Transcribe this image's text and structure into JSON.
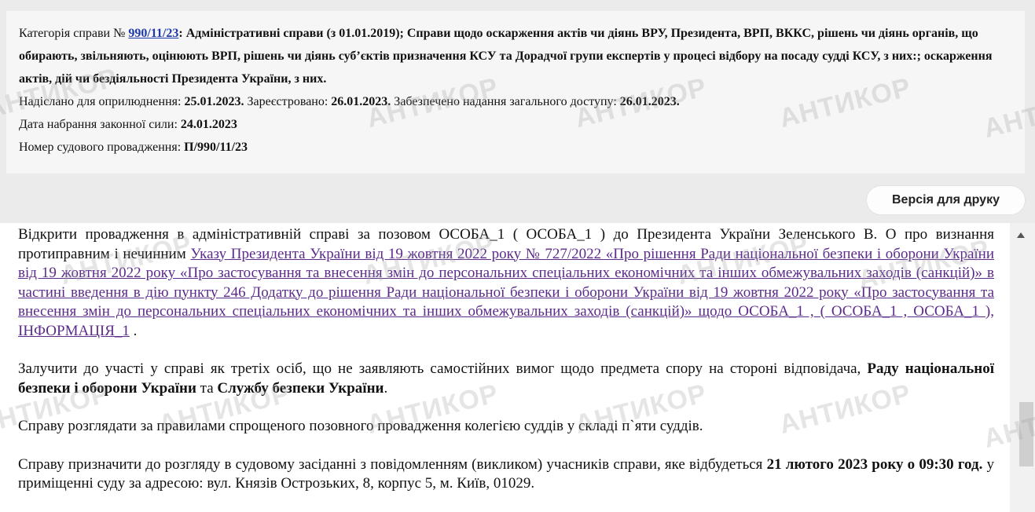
{
  "info": {
    "category_label": "Категорія справи № ",
    "category_link": "990/11/23",
    "category_text": ": Адміністративні справи (з 01.01.2019); Справи щодо оскарження актів чи діянь ВРУ, Президента, ВРП, ВККС, рішень чи діянь органів, що обирають, звільняють, оцінюють ВРП, рішень чи діянь суб’єктів призначення КСУ та Дорадчої групи експертів у процесі відбору на посаду судді КСУ, з них:; оскарження актів, дій чи бездіяльності Президента України, з них.",
    "sent_label": "Надіслано для оприлюднення: ",
    "sent_value": "25.01.2023.",
    "registered_label": " Зареєстровано: ",
    "registered_value": "26.01.2023.",
    "access_label": " Забезпечено надання загального доступу: ",
    "access_value": "26.01.2023.",
    "effective_label": "Дата набрання законної сили: ",
    "effective_value": "24.01.2023",
    "proceeding_label": "Номер судового провадження: ",
    "proceeding_value": "П/990/11/23"
  },
  "print_button": "Версія для друку",
  "document": {
    "p1_start": "Відкрити провадження в адміністративній справі за позовом ОСОБА_1 ( ОСОБА_1 ) до Президента України Зеленського В. О про визнання протиправним і нечинним ",
    "p1_link": "Указу Президента України від 19 жовтня 2022 року № 727/2022 «Про рішення Ради національної безпеки і оборони України від 19 жовтня 2022 року «Про застосування та внесення змін до персональних спеціальних економічних та інших обмежувальних заходів (санкцій)» в частині введення в дію пункту 246 Додатку до рішення Ради національної безпеки і оборони України від 19 жовтня 2022 року «Про застосування та внесення змін до персональних спеціальних економічних та інших обмежувальних заходів (санкцій)» щодо ОСОБА_1 , ( ОСОБА_1 , ОСОБА_1 ), ІНФОРМАЦІЯ_1",
    "p1_end": " .",
    "p2_start": "Залучити до участі у справі як третіх осіб, що не заявляють самостійних вимог щодо предмета спору на стороні відповідача, ",
    "p2_bold1": "Раду національної безпеки і оборони України",
    "p2_mid": " та ",
    "p2_bold2": "Службу безпеки України",
    "p2_end": ".",
    "p3": "Справу розглядати за правилами спрощеного позовного провадження колегією суддів у складі п`яти суддів.",
    "p4_start": "Справу призначити до розгляду в судовому засіданні з повідомленням (викликом) учасників справи, яке відбудеться ",
    "p4_bold": "21 лютого 2023 року о 09:30 год.",
    "p4_end": " у приміщенні суду за адресою: вул. Князів Острозьких, 8, корпус 5, м. Київ, 01029."
  },
  "watermark": "АНТИКОР",
  "colors": {
    "link": "#1d3aa8",
    "visited_link": "#5b2b8a",
    "panel_bg": "#f6f6f6"
  }
}
